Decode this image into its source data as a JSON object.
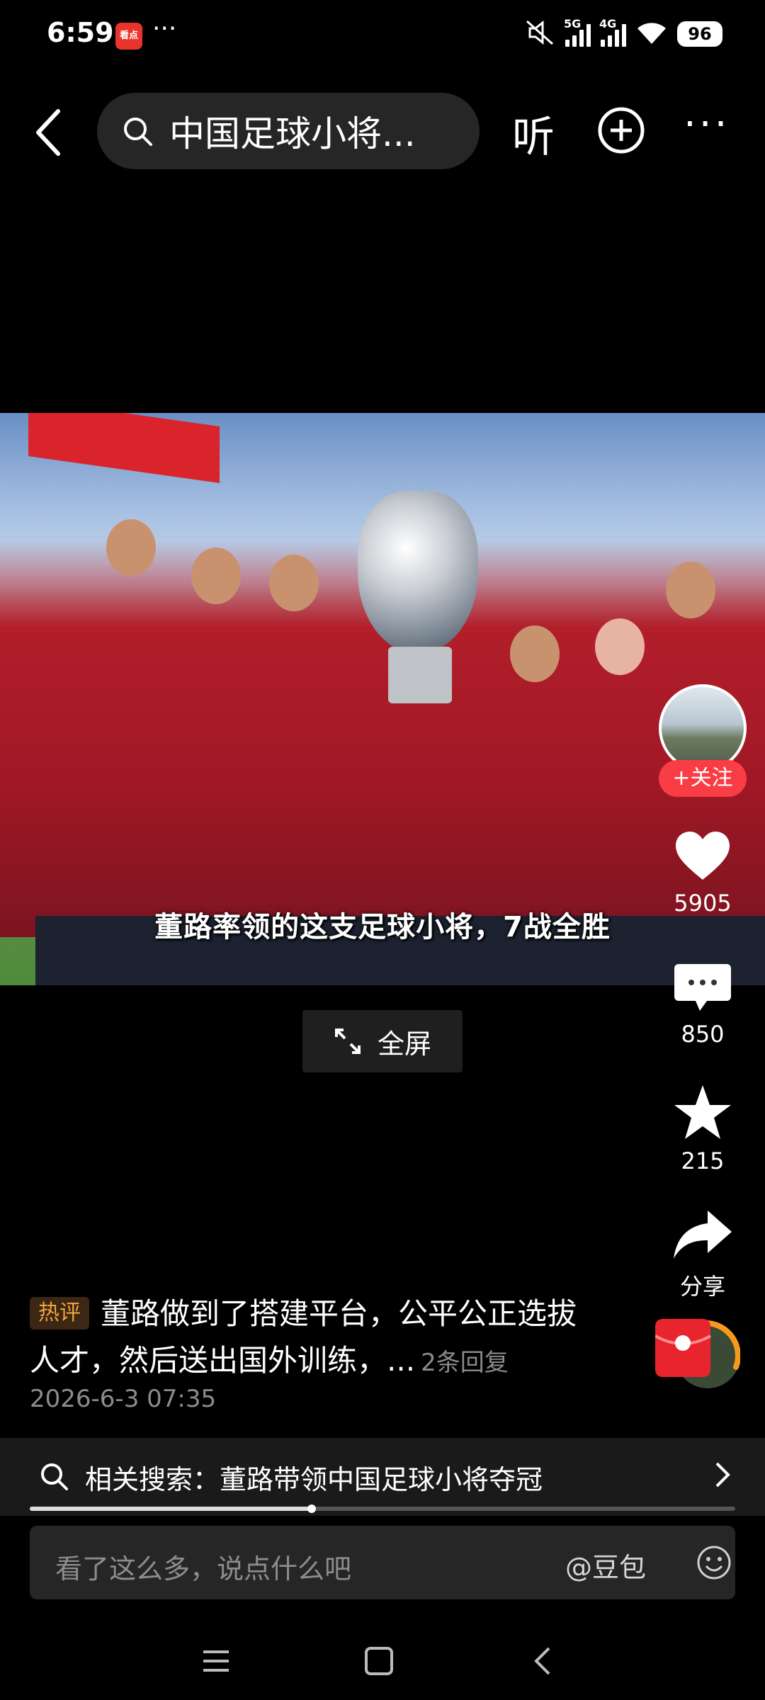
{
  "status_bar": {
    "time": "6:59",
    "app_badge": "看点",
    "overflow": "···",
    "net1": "5G",
    "net2": "4G",
    "battery": "96"
  },
  "topbar": {
    "search_query": "中国足球小将...",
    "listen_label": "听",
    "more_label": "···"
  },
  "video": {
    "caption": "董路率领的这支足球小将，7战全胜"
  },
  "fullscreen_label": "全屏",
  "author": {
    "follow_label": "+关注"
  },
  "actions": {
    "likes": "5905",
    "comments": "850",
    "favorites": "215",
    "share_label": "分享"
  },
  "hot_comment": {
    "tag": "热评",
    "text": "董路做到了搭建平台，公平公正选拔人才，然后送出国外训练，...",
    "replies": "2条回复",
    "date": "2026-6-3 07:35"
  },
  "related": {
    "label": "相关搜索：董路带领中国足球小将夺冠"
  },
  "progress": 0.4,
  "input": {
    "placeholder": "看了这么多，说点什么吧",
    "at_label": "@豆包"
  },
  "colors": {
    "follow": "#fa3c45",
    "tag_text": "#f2a43a"
  }
}
